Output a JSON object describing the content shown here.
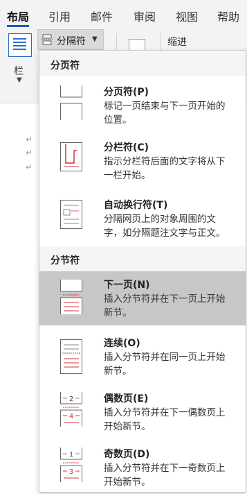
{
  "ribbon": {
    "tabs": [
      "布局",
      "引用",
      "邮件",
      "审阅",
      "视图",
      "帮助"
    ],
    "columns_label": "栏",
    "breaks_label": "分隔符",
    "indent_label": "缩进"
  },
  "menu": {
    "page_breaks_header": "分页符",
    "section_breaks_header": "分节符",
    "items": [
      {
        "title": "分页符(P)",
        "desc_line1": "标记一页结束与下一页开始的",
        "desc_line2": "位置。"
      },
      {
        "title": "分栏符(C)",
        "desc_line1": "指示分栏符后面的文字将从下",
        "desc_line2": "一栏开始。"
      },
      {
        "title": "自动换行符(T)",
        "desc_line1": "分隔网页上的对象周围的文",
        "desc_line2": "字，如分隔题注文字与正文。"
      },
      {
        "title": "下一页(N)",
        "desc_line1": "插入分节符并在下一页上开始",
        "desc_line2": "新节。"
      },
      {
        "title": "连续(O)",
        "desc_line1": "插入分节符并在同一页上开始",
        "desc_line2": "新节。"
      },
      {
        "title": "偶数页(E)",
        "desc_line1": "插入分节符并在下一偶数页上",
        "desc_line2": "开始新节。"
      },
      {
        "title": "奇数页(D)",
        "desc_line1": "插入分节符并在下一奇数页上",
        "desc_line2": "开始新节。"
      }
    ],
    "even_icon_numbers": [
      "2",
      "4"
    ],
    "odd_icon_numbers": [
      "1",
      "3"
    ]
  },
  "document": {
    "paragraph_mark": "↵"
  },
  "colors": {
    "accent_blue": "#185abd",
    "break_red": "#d13438",
    "highlight": "#c7c7c7"
  }
}
